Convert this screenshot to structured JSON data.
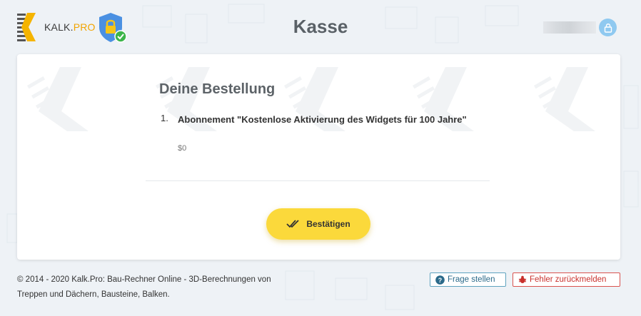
{
  "header": {
    "logo_text_main": "KALK.",
    "logo_text_accent": "PRO",
    "title": "Kasse"
  },
  "order": {
    "heading": "Deine Bestellung",
    "items": [
      {
        "number": "1.",
        "name": "Abonnement \"Kostenlose Aktivierung des Widgets für 100 Jahre\"",
        "price": "$0"
      }
    ]
  },
  "actions": {
    "confirm_label": "Bestätigen"
  },
  "footer": {
    "copyright_line1": "© 2014 - 2020 Kalk.Pro: Bau-Rechner Online - 3D-Berechnungen von",
    "copyright_line2": "Treppen und Dächern, Bausteine, Balken.",
    "question_label": "Frage stellen",
    "report_error_label": "Fehler zurückmelden"
  },
  "colors": {
    "accent_yellow": "#fbd93b",
    "brand_orange": "#f1a400",
    "info_blue": "#2b6a8a",
    "error_red": "#c9302c"
  },
  "icons": {
    "logo": "kalk-pro-logo",
    "secure_badge": "shield-lock-check-icon",
    "user_lock": "lock-icon",
    "confirm": "double-check-icon",
    "question": "question-circle-icon",
    "bug": "bug-icon"
  }
}
